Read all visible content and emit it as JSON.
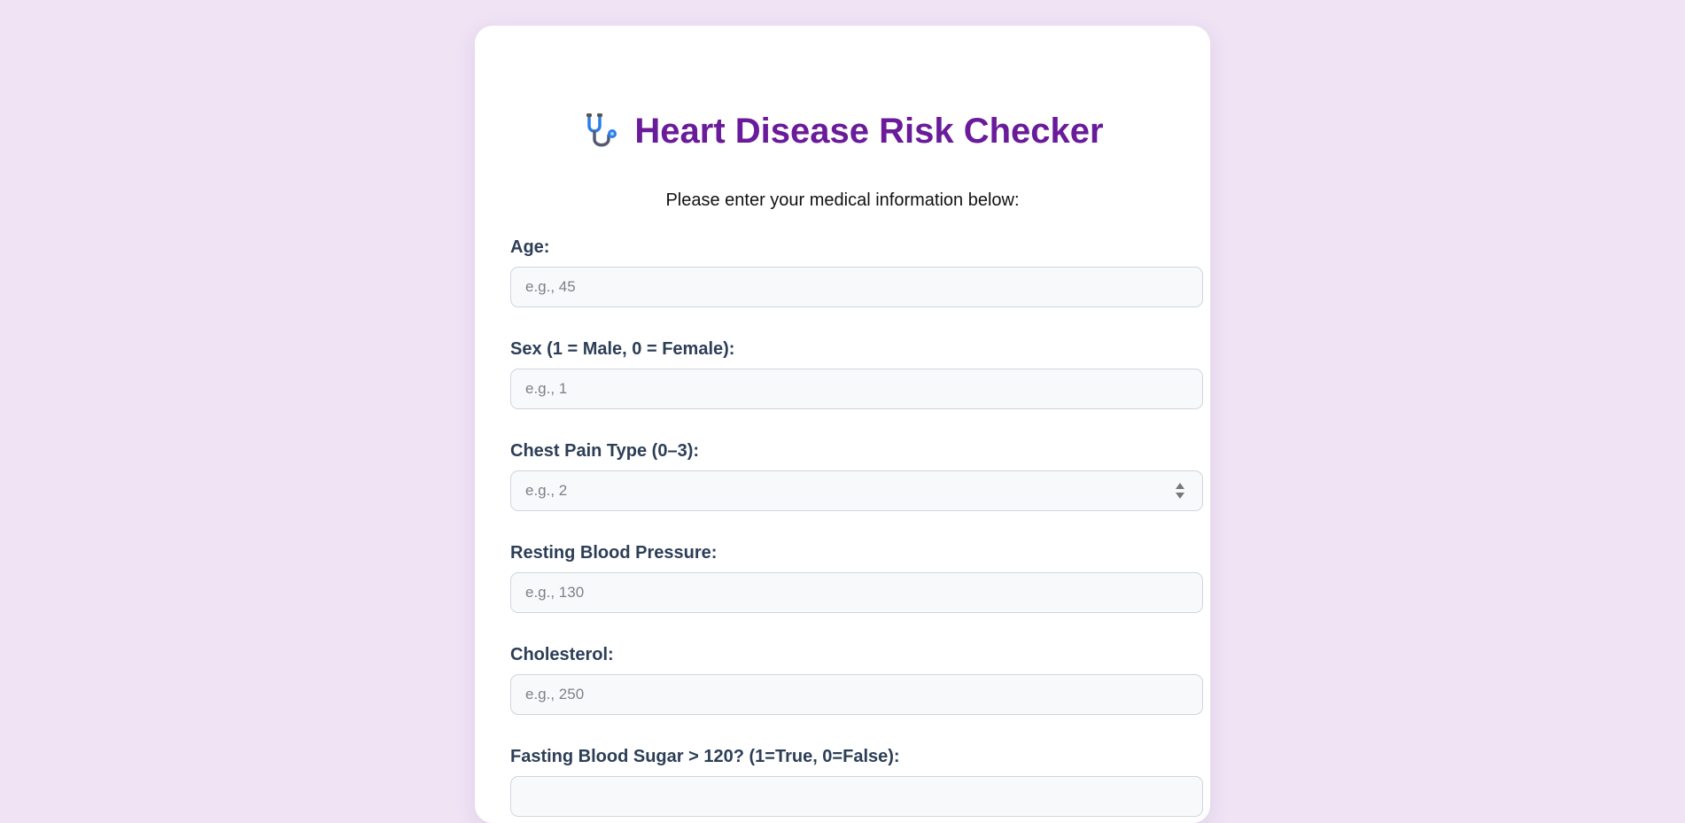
{
  "header": {
    "icon": "stethoscope-icon",
    "title": "Heart Disease Risk Checker",
    "subtitle": "Please enter your medical information below:"
  },
  "form": {
    "fields": [
      {
        "label": "Age:",
        "placeholder": "e.g., 45"
      },
      {
        "label": "Sex (1 = Male, 0 = Female):",
        "placeholder": "e.g., 1"
      },
      {
        "label": "Chest Pain Type (0–3):",
        "placeholder": "e.g., 2"
      },
      {
        "label": "Resting Blood Pressure:",
        "placeholder": "e.g., 130"
      },
      {
        "label": "Cholesterol:",
        "placeholder": "e.g., 250"
      },
      {
        "label": "Fasting Blood Sugar > 120? (1=True, 0=False):",
        "placeholder": ""
      }
    ]
  },
  "colors": {
    "background": "#efe3f4",
    "title": "#6a1b9a",
    "label": "#2c3e57",
    "icon_accent": "#2b7de9"
  }
}
